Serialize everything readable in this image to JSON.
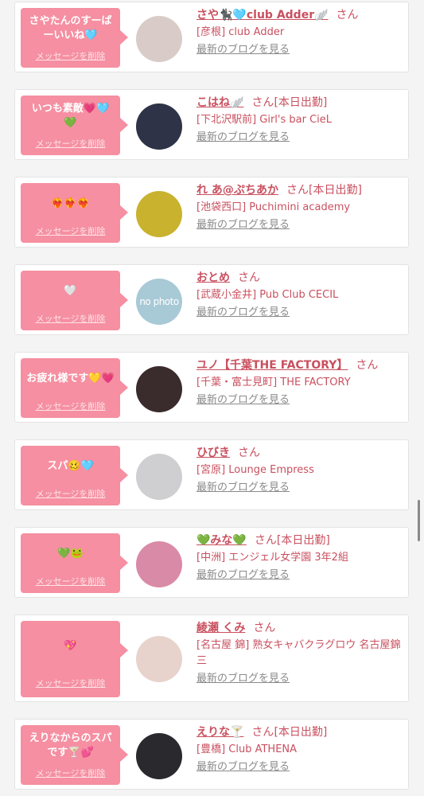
{
  "colors": {
    "bubble": "#f58fa1",
    "accent_text": "#c9505f",
    "link_gray": "#8a8a8a",
    "background": "#f4f4f4"
  },
  "entries": [
    {
      "message": "さやたんのすーばーいいね🩵",
      "delete_label": "メッセージを削除",
      "name": "さや🐈‍⬛🩵club Adder🪽",
      "honorific": "さん",
      "duty": "",
      "shop": "[彦根] club Adder",
      "blog_label": "最新のブログを見る"
    },
    {
      "message": "いつも素敵💗🩵💚",
      "delete_label": "メッセージを削除",
      "name": "こはね🪽",
      "honorific": "さん",
      "duty": "[本日出勤]",
      "shop": "[下北沢駅前] Girl's bar CieL",
      "blog_label": "最新のブログを見る"
    },
    {
      "message": "❤️‍🔥❤️‍🔥❤️‍🔥",
      "delete_label": "メッセージを削除",
      "name": "れ あ@ぷちあか",
      "honorific": "さん",
      "duty": "[本日出勤]",
      "shop": "[池袋西口] Puchimini academy",
      "blog_label": "最新のブログを見る"
    },
    {
      "message": "🤍",
      "delete_label": "メッセージを削除",
      "name": "おとめ",
      "honorific": "さん",
      "duty": "",
      "shop": "[武蔵小金井] Pub Club CECIL",
      "blog_label": "最新のブログを見る",
      "avatar_text": "no photo"
    },
    {
      "message": "お疲れ様です💛💗",
      "delete_label": "メッセージを削除",
      "name": "ユノ【千葉THE FACTORY】",
      "honorific": "さん",
      "duty": "",
      "shop": "[千葉・富士見町] THE FACTORY",
      "blog_label": "最新のブログを見る"
    },
    {
      "message": "スパ🥴🩵",
      "delete_label": "メッセージを削除",
      "name": "ひびき",
      "honorific": "さん",
      "duty": "",
      "shop": "[宮原] Lounge Empress",
      "blog_label": "最新のブログを見る"
    },
    {
      "message": "💚🐸",
      "delete_label": "メッセージを削除",
      "name": "💚みな💚",
      "honorific": "さん",
      "duty": "[本日出勤]",
      "shop": "[中洲] エンジェル女学園 3年2組",
      "blog_label": "最新のブログを見る"
    },
    {
      "message": "💖",
      "delete_label": "メッセージを削除",
      "name": "綾瀬 くみ",
      "honorific": "さん",
      "duty": "",
      "shop": "[名古屋 錦] 熟女キャバクラグロウ 名古屋錦三",
      "blog_label": "最新のブログを見る"
    },
    {
      "message": "えりなからのスパです🍸💕",
      "delete_label": "メッセージを削除",
      "name": "えりな🍸",
      "honorific": "さん",
      "duty": "[本日出勤]",
      "shop": "[豊橋] Club ATHENA",
      "blog_label": "最新のブログを見る"
    }
  ]
}
